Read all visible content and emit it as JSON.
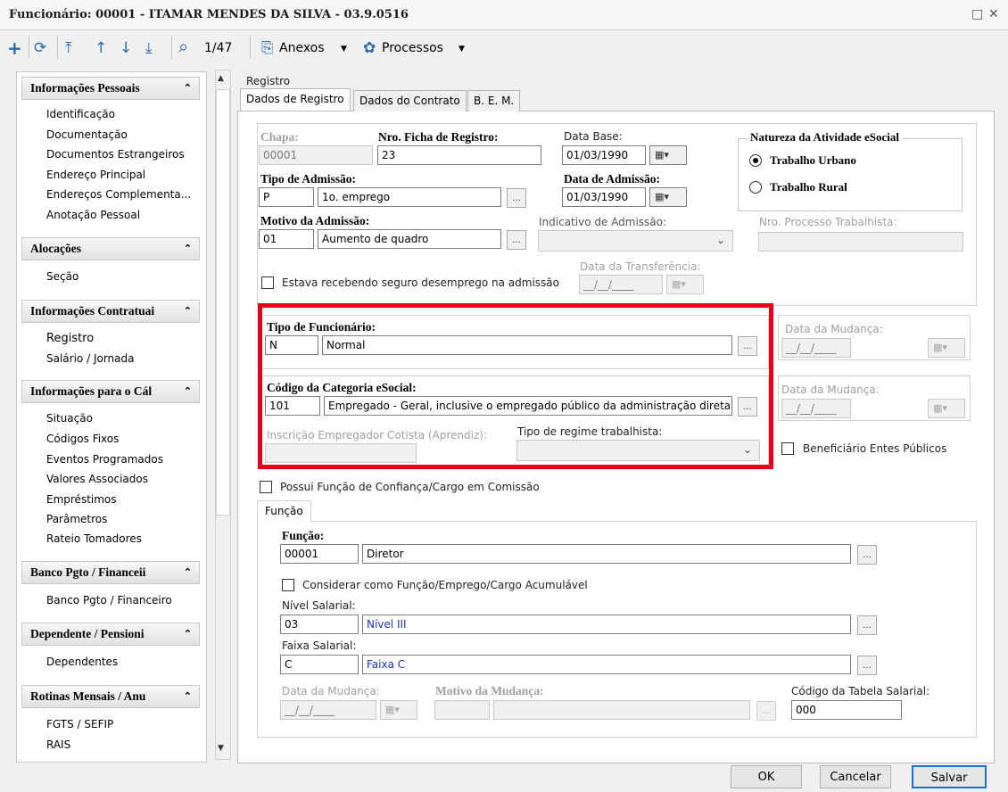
{
  "window": {
    "title": "Funcionário: 00001 - ITAMAR MENDES DA SILVA - 03.9.0516",
    "maximize_glyph": "□",
    "close_glyph": "✕"
  },
  "toolbar": {
    "add_glyph": "+",
    "refresh_glyph": "⟳",
    "first_glyph": "⤒",
    "prev_glyph": "↑",
    "next_glyph": "↓",
    "last_glyph": "⤓",
    "search_glyph": "⌕",
    "record_counter": "1/47",
    "attachments_label": "Anexos",
    "attachments_glyph": "⎘",
    "processes_label": "Processos",
    "processes_glyph": "✿",
    "dropdown_glyph": "▼"
  },
  "sidebar": {
    "chevron": "⌃",
    "groups": [
      {
        "title": "Informações Pessoais",
        "items": [
          "Identificação",
          "Documentação",
          "Documentos Estrangeiros",
          "Endereço Principal",
          "Endereços Complementa...",
          "Anotação Pessoal"
        ]
      },
      {
        "title": "Alocações",
        "items": [
          "Seção"
        ]
      },
      {
        "title": "Informações Contratuai",
        "items": [
          "Registro",
          "Salário / Jornada"
        ]
      },
      {
        "title": "Informações para o Cál",
        "items": [
          "Situação",
          "Códigos Fixos",
          "Eventos Programados",
          "Valores Associados",
          "Empréstimos",
          "Parâmetros",
          "Rateio Tomadores"
        ]
      },
      {
        "title": "Banco Pgto / Financeii",
        "items": [
          "Banco Pgto / Financeiro"
        ]
      },
      {
        "title": "Dependente / Pensioni",
        "items": [
          "Dependentes"
        ]
      },
      {
        "title": "Rotinas Mensais / Anu",
        "items": [
          "FGTS / SEFIP",
          "RAIS"
        ]
      }
    ],
    "scroll_up": "▲",
    "scroll_down": "▼"
  },
  "section_title": "Registro",
  "tabs": [
    "Dados de Registro",
    "Dados do Contrato",
    "B. E. M."
  ],
  "registro": {
    "chapa_label": "Chapa:",
    "chapa_value": "00001",
    "ficha_label": "Nro. Ficha de Registro:",
    "ficha_value": "23",
    "data_base_label": "Data Base:",
    "data_base_value": "01/03/1990",
    "tipo_admissao_label": "Tipo de Admissão:",
    "tipo_admissao_code": "P",
    "tipo_admissao_desc": "1o. emprego",
    "data_admissao_label": "Data de Admissão:",
    "data_admissao_value": "01/03/1990",
    "motivo_label": "Motivo da Admissão:",
    "motivo_code": "01",
    "motivo_desc": "Aumento de quadro",
    "indicativo_label": "Indicativo de Admissão:",
    "processo_label": "Nro. Processo Trabalhista:",
    "seguro_label": "Estava recebendo seguro desemprego na admissão",
    "data_transf_label": "Data da Transferência:",
    "date_placeholder": "__/__/____",
    "natureza_title": "Natureza da Atividade eSocial",
    "natureza_urbano": "Trabalho Urbano",
    "natureza_rural": "Trabalho Rural"
  },
  "funcionario": {
    "tipo_label": "Tipo de Funcionário:",
    "tipo_code": "N",
    "tipo_desc": "Normal",
    "categoria_label": "Código da Categoria eSocial:",
    "categoria_code": "101",
    "categoria_desc": "Empregado - Geral, inclusive o empregado público da administração direta o",
    "inscricao_label": "Inscrição Empregador Cotista (Aprendiz):",
    "regime_label": "Tipo de regime trabalhista:",
    "data_mudanca_label": "Data da Mudança:",
    "beneficiario_label": "Beneficiário Entes Públicos",
    "funcao_confianca_label": "Possui Função de Confiança/Cargo em Comissão"
  },
  "funcao": {
    "tab_label": "Função",
    "funcao_label": "Função:",
    "funcao_code": "00001",
    "funcao_desc": "Diretor",
    "acumulavel_label": "Considerar como Função/Emprego/Cargo Acumulável",
    "nivel_label": "Nível Salarial:",
    "nivel_code": "03",
    "nivel_desc": "Nível III",
    "faixa_label": "Faixa Salarial:",
    "faixa_code": "C",
    "faixa_desc": "Faixa C",
    "data_mudanca_label": "Data da Mudança:",
    "motivo_mudanca_label": "Motivo da Mudança:",
    "tabela_label": "Código da Tabela Salarial:",
    "tabela_value": "000"
  },
  "buttons": {
    "ok": "OK",
    "cancel": "Cancelar",
    "save": "Salvar"
  },
  "glyphs": {
    "dots": "...",
    "cal": "▦▾",
    "chev": "⌄"
  }
}
